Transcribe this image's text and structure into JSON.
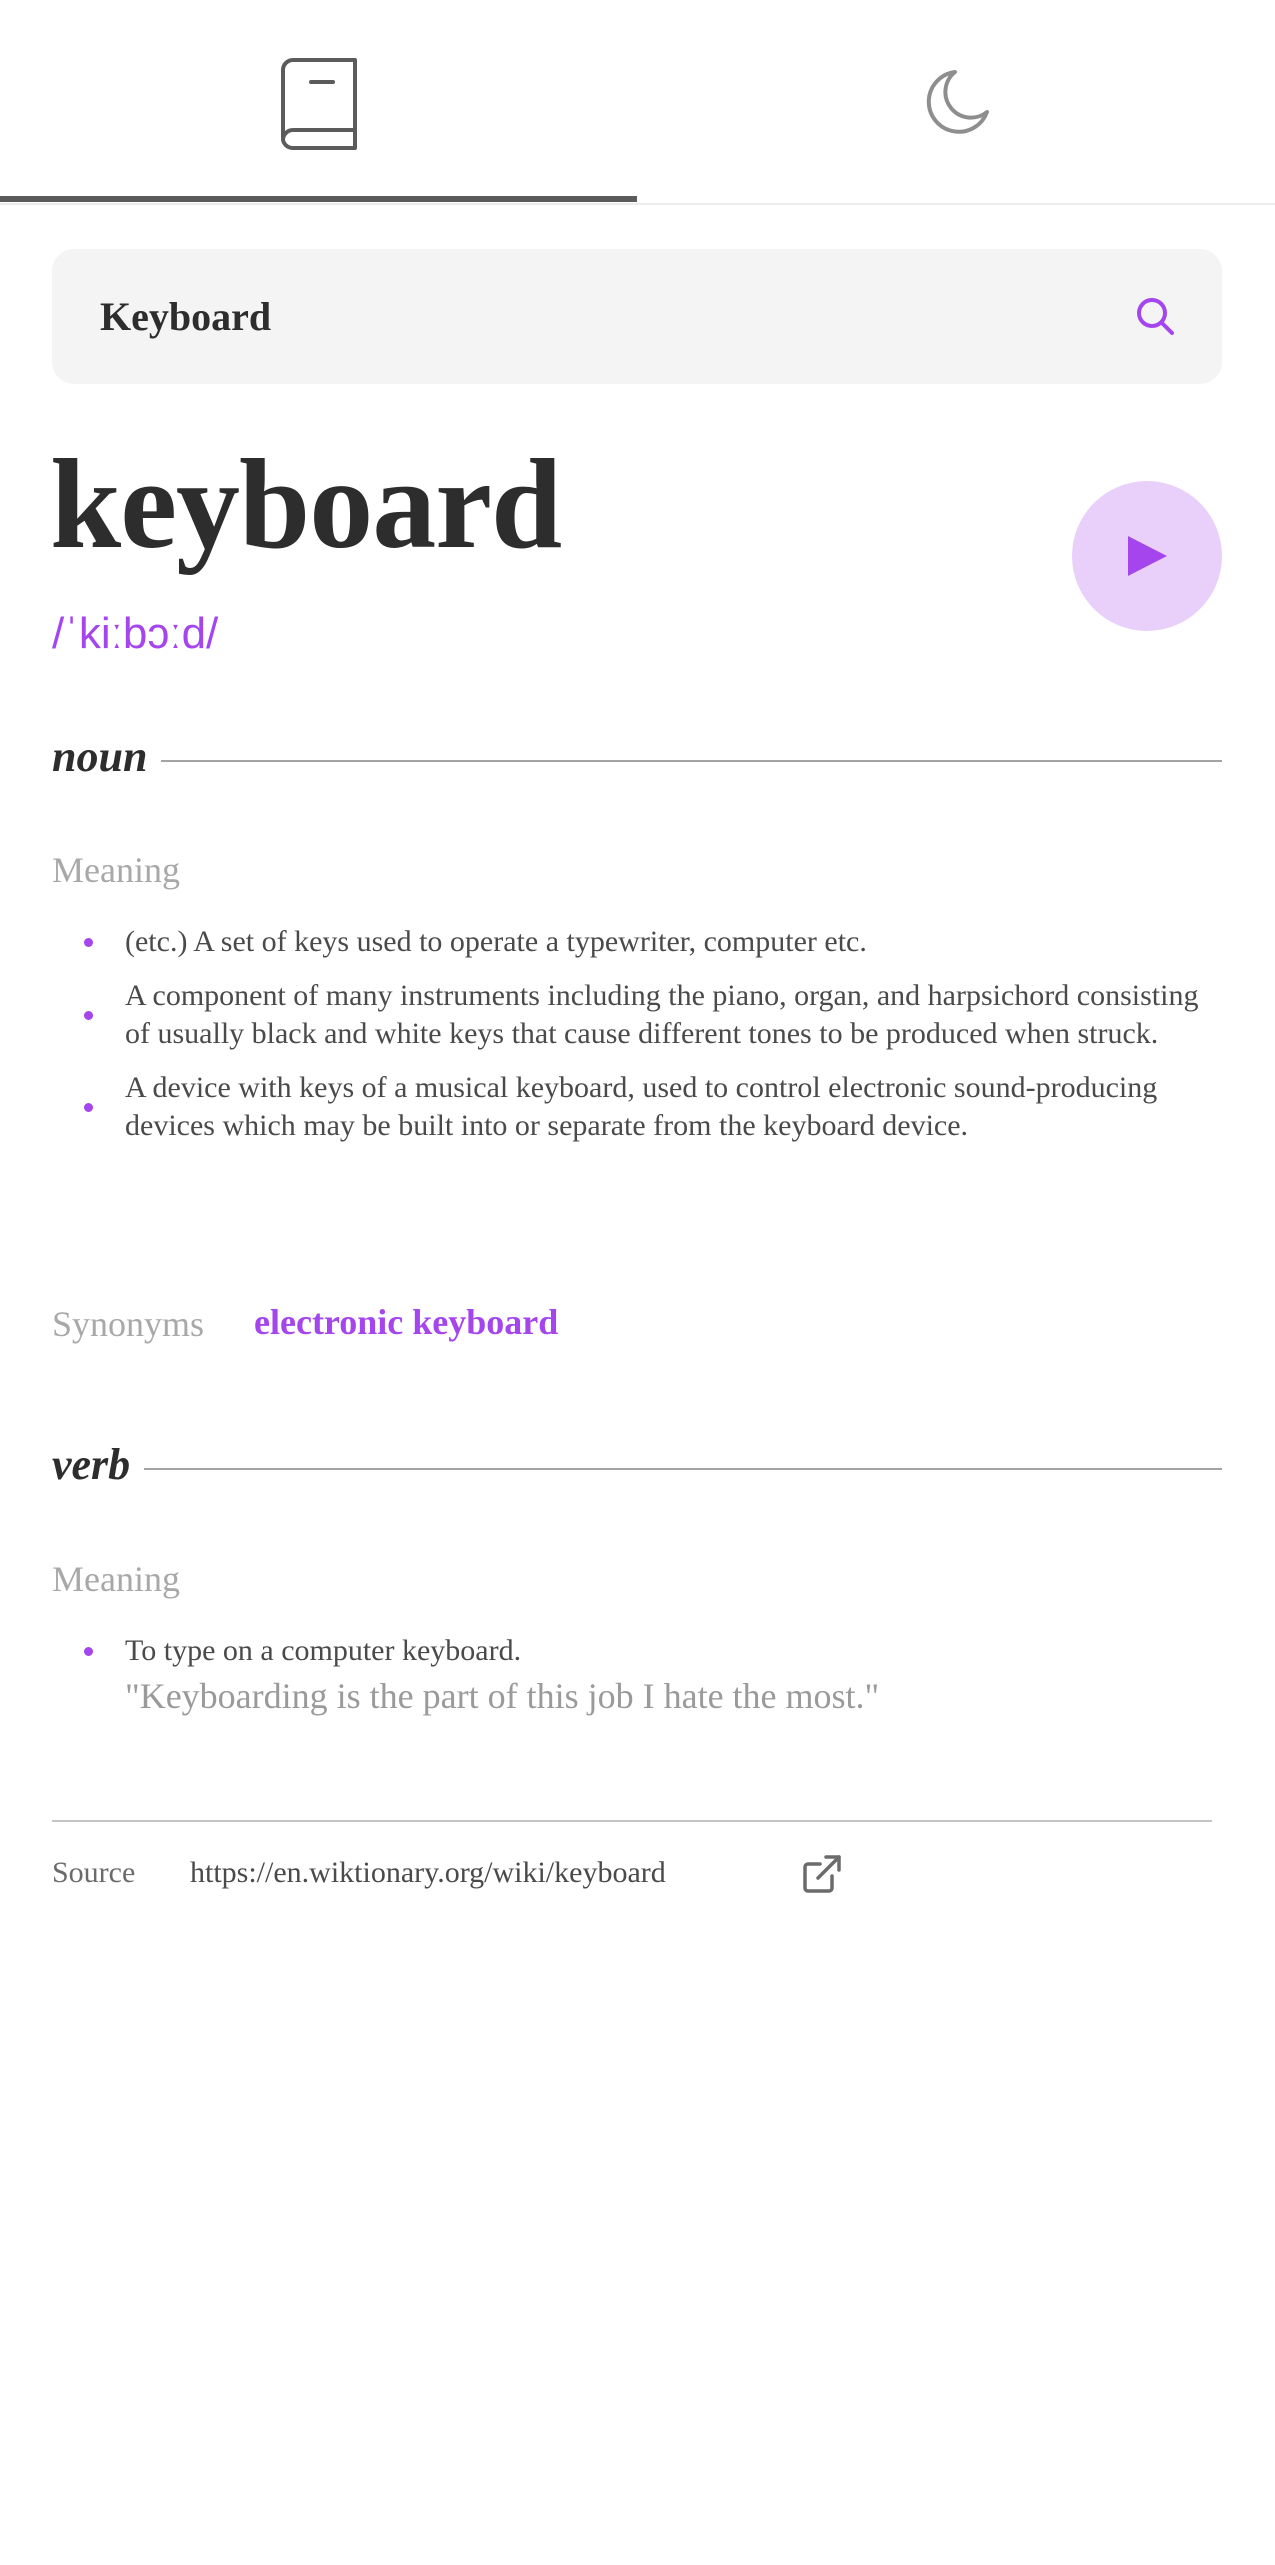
{
  "tabs": [
    {
      "icon": "book-icon",
      "active": true
    },
    {
      "icon": "moon-icon",
      "active": false
    }
  ],
  "search": {
    "value": "Keyboard",
    "icon": "search-icon"
  },
  "entry": {
    "word": "keyboard",
    "phonetic": "/ˈkiːbɔːd/",
    "play_icon": "play-icon"
  },
  "noun": {
    "label": "noun",
    "meaning_label": "Meaning",
    "definitions": [
      "(etc.) A set of keys used to operate a typewriter, computer etc.",
      "A component of many instruments including the piano, organ, and harpsichord consisting of usually black and white keys that cause different tones to be produced when struck.",
      "A device with keys of a musical keyboard, used to control electronic sound-producing devices which may be built into or separate from the keyboard device."
    ],
    "synonyms_label": "Synonyms",
    "synonyms": [
      "electronic keyboard"
    ]
  },
  "verb": {
    "label": "verb",
    "meaning_label": "Meaning",
    "definitions": [
      "To type on a computer keyboard."
    ],
    "example": "\"Keyboarding is the part of this job I hate the most.\""
  },
  "source": {
    "label": "Source",
    "url": "https://en.wiktionary.org/wiki/keyboard",
    "icon": "external-link-icon"
  },
  "colors": {
    "accent": "#a445ed",
    "accent_light": "#e9d0fa",
    "text": "#2d2d2d",
    "muted": "#a8a8a8"
  }
}
